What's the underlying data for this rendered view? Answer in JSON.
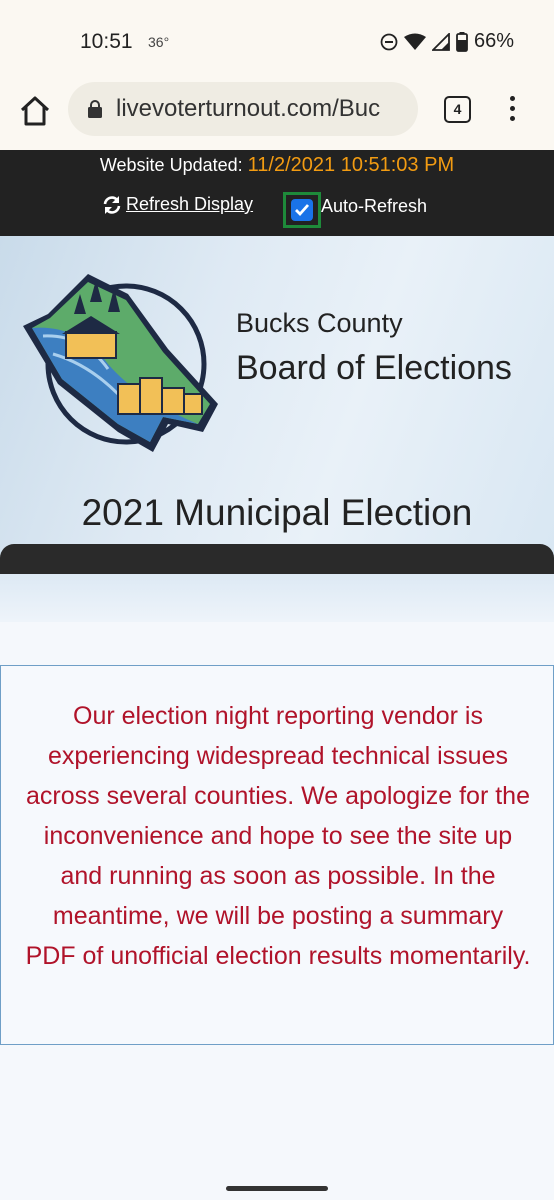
{
  "status_bar": {
    "time": "10:51",
    "temperature": "36°",
    "battery": "66%"
  },
  "browser": {
    "url": "livevoterturnout.com/Buc",
    "tab_count": "4"
  },
  "update_bar": {
    "label": "Website Updated:",
    "timestamp": "11/2/2021 10:51:03 PM",
    "refresh_label": "Refresh Display",
    "auto_refresh_label": "Auto-Refresh",
    "auto_refresh_checked": true,
    "timestamp_color": "#f39c12"
  },
  "header": {
    "org_line1": "Bucks County",
    "org_line2": "Board of Elections",
    "election_title": "2021 Municipal Election"
  },
  "notice": {
    "text": "Our election night reporting vendor is experiencing widespread technical issues across several counties. We apologize for the inconvenience and hope to see the site up and running as soon as possible. In the meantime, we will be posting a summary PDF of unofficial election results momentarily.",
    "color": "#b0132a"
  }
}
